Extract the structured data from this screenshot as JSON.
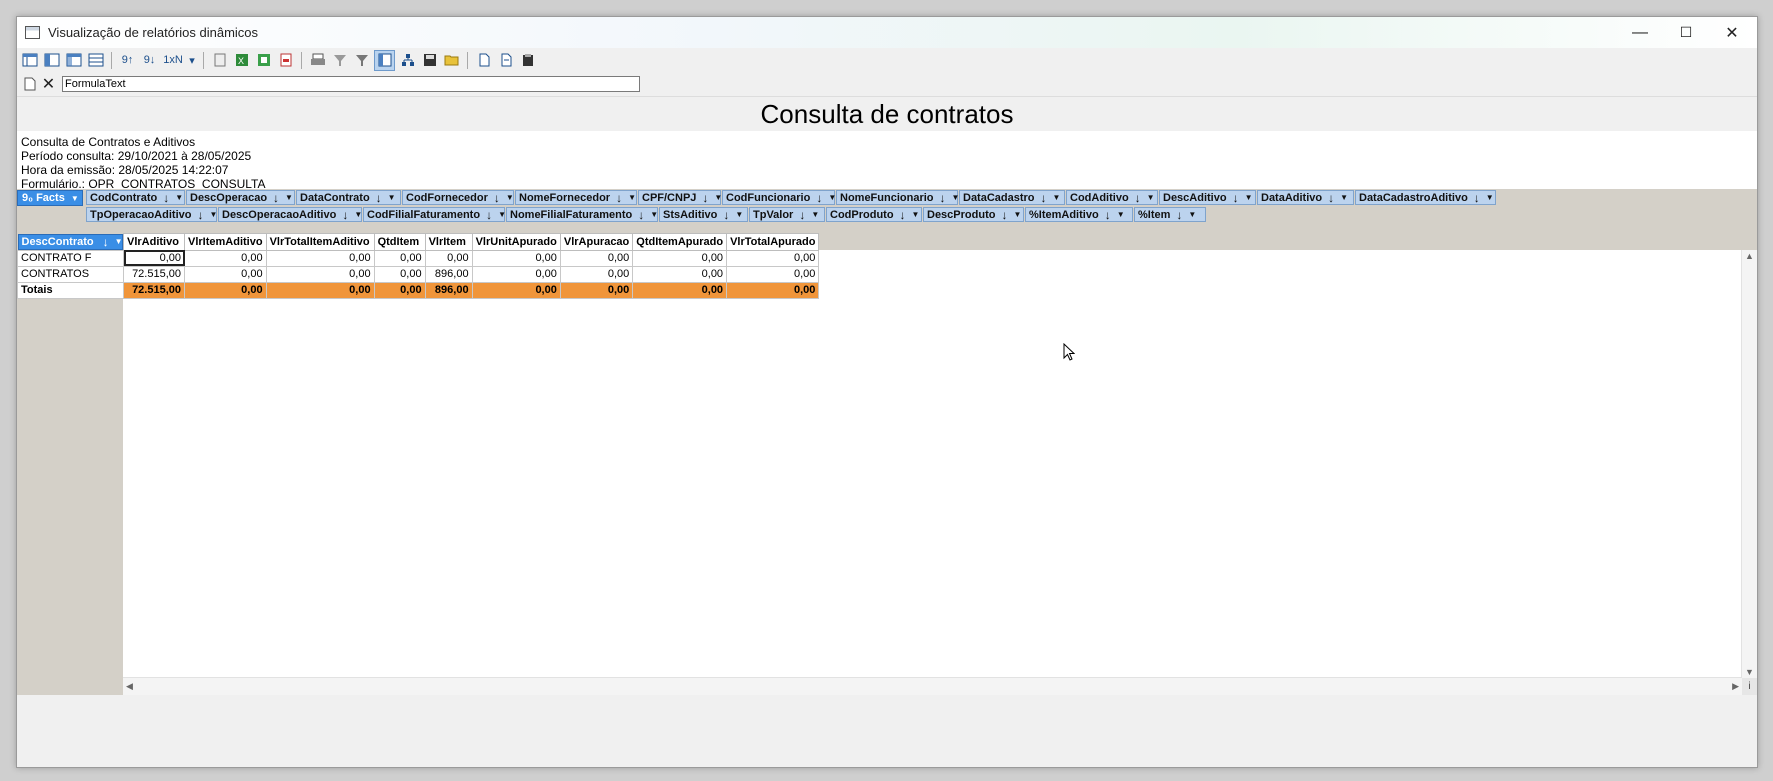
{
  "window": {
    "title": "Visualização de relatórios dinâmicos",
    "minimize": "—",
    "maximize": "☐",
    "close": "✕"
  },
  "toolbar": {
    "formula_value": "FormulaText"
  },
  "report": {
    "title": "Consulta de contratos",
    "info_lines": [
      "Consulta de Contratos e Aditivos",
      "Período consulta: 29/10/2021 à 28/05/2025",
      "Hora da emissão: 28/05/2025 14:22:07",
      "Formulário.: OPR_CONTRATOS_CONSULTA"
    ]
  },
  "pivot": {
    "facts_label": "Facts",
    "facts_prefix": "9₀",
    "fields_row1": [
      "CodContrato",
      "DescOperacao",
      "DataContrato",
      "CodFornecedor",
      "NomeFornecedor",
      "CPF/CNPJ",
      "CodFuncionario",
      "NomeFuncionario",
      "DataCadastro",
      "CodAditivo",
      "DescAditivo",
      "DataAditivo",
      "DataCadastroAditivo"
    ],
    "fields_row2": [
      "TpOperacaoAditivo",
      "DescOperacaoAditivo",
      "CodFilialFaturamento",
      "NomeFilialFaturamento",
      "StsAditivo",
      "TpValor",
      "CodProduto",
      "DescProduto",
      "%ItemAditivo",
      "%Item"
    ],
    "row_field": "DescContrato",
    "columns": [
      "VlrAditivo",
      "VlrItemAditivo",
      "VlrTotalItemAditivo",
      "QtdItem",
      "VlrItem",
      "VlrUnitApurado",
      "VlrApuracao",
      "QtdItemApurado",
      "VlrTotalApurado"
    ],
    "rows": [
      {
        "label": "CONTRATO F",
        "values": [
          "0,00",
          "0,00",
          "0,00",
          "0,00",
          "0,00",
          "0,00",
          "0,00",
          "0,00",
          "0,00"
        ]
      },
      {
        "label": "CONTRATOS",
        "values": [
          "72.515,00",
          "0,00",
          "0,00",
          "0,00",
          "896,00",
          "0,00",
          "0,00",
          "0,00",
          "0,00"
        ]
      }
    ],
    "totals": {
      "label": "Totais",
      "values": [
        "72.515,00",
        "0,00",
        "0,00",
        "0,00",
        "896,00",
        "0,00",
        "0,00",
        "0,00",
        "0,00"
      ]
    }
  },
  "colors": {
    "accent_blue": "#3a8ee6",
    "field_chip": "#bcd3ee",
    "totals_orange": "#f0953a"
  }
}
